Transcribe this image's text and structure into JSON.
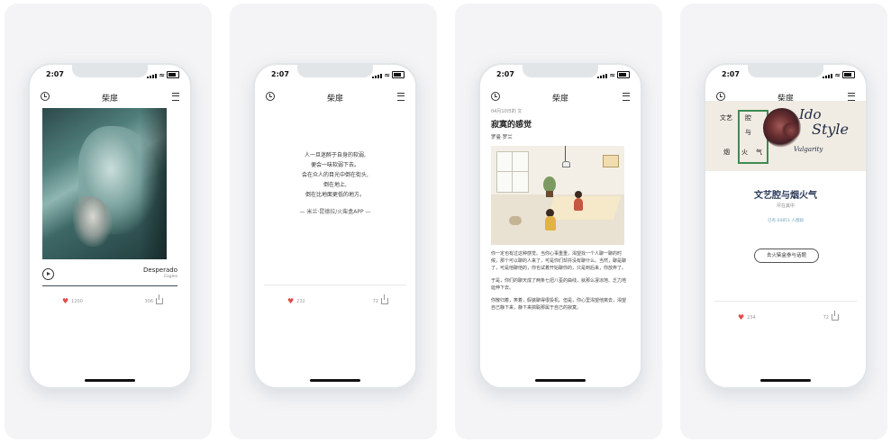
{
  "status": {
    "time": "2:07"
  },
  "nav": {
    "title": "柴扉"
  },
  "phone1": {
    "song_title": "Desperado",
    "song_artist": "Eagles",
    "likes": "1200",
    "shares": "306"
  },
  "phone2": {
    "quote_lines": [
      "人一旦迷醉于自身的软弱,",
      "便会一味软弱下去。",
      "会在众人的目光中倒在街头,",
      "倒在地上,",
      "倒在比地面更低的地方。"
    ],
    "attribution": "— 米兰·昆德拉/火柴盒APP —",
    "likes": "232",
    "shares": "72"
  },
  "phone3": {
    "meta": "04月10日的 文",
    "title": "寂寞的感觉",
    "author": "罗曼·罗兰",
    "paragraphs": [
      "你一定也有过这种感觉。当你心事重重，渴望找一个人聊一聊的时候，那个可以聊的人来了，可是你们却并没有聊什么。当然，聊是聊了，可是他聊他的，你也试着开始聊你的，只是到后来，你放弃了。",
      "于是，你们的聊天成了两条七扭八歪的曲线，就那么凄凉地、乏力地延伸下去。",
      "你散归着，笑着，假装聊得很投机。但是，你心里渴望他离去，渴望自己静下来，静下来搞聪那属于自己的寂寞。"
    ]
  },
  "phone4": {
    "banner_zh": [
      "文艺",
      "腔",
      "与",
      "烟",
      "火",
      "气"
    ],
    "banner_script_1": "Ido",
    "banner_script_2": "Style",
    "banner_script_3": "Vulgarity",
    "topic_title": "文艺腔与烟火气",
    "topic_sub": "尽在其中",
    "topic_stats": "已有  64851  人围观",
    "join_label": "去火柴盒参与话题",
    "likes": "234",
    "shares": "72"
  },
  "colors": {
    "heart": "#e14b4b",
    "topic_title": "#2a3a5a",
    "stats": "#6fa3bf"
  },
  "icons": [
    "clock-icon",
    "menu-icon",
    "play-icon",
    "heart-icon",
    "share-icon"
  ]
}
